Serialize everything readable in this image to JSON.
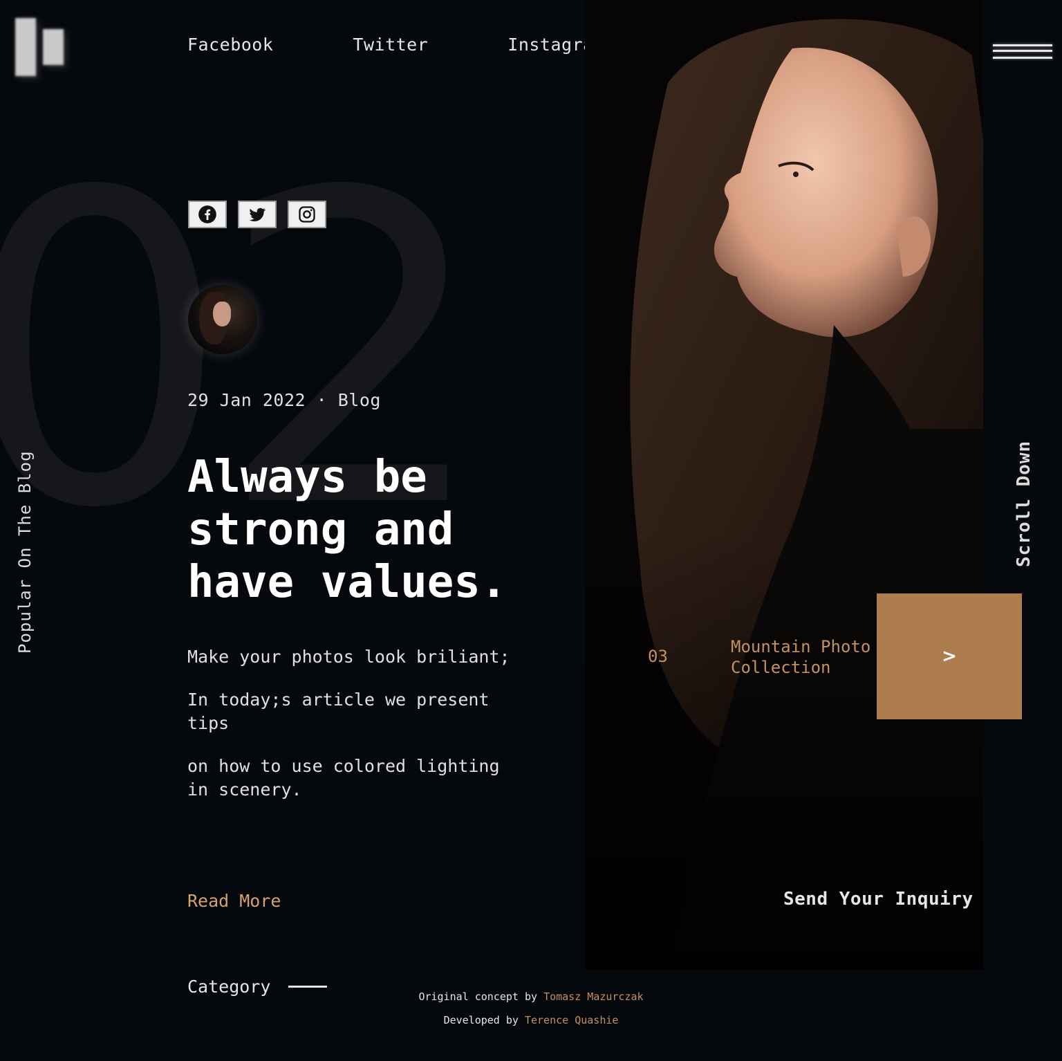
{
  "nav": {
    "links": [
      "Facebook",
      "Twitter",
      "Instagram"
    ]
  },
  "background_number": "02",
  "side_label": "Popular On The Blog",
  "social_icons": [
    "facebook-icon",
    "twitter-icon",
    "instagram-icon"
  ],
  "post": {
    "date": "29 Jan 2022",
    "separator": "·",
    "category": "Blog",
    "title_lines": [
      "Always be",
      "strong and",
      "have values."
    ],
    "paragraphs": [
      "Make your photos look briliant;",
      "In today;s article we present tips",
      "on how to use colored lighting in scenery."
    ],
    "read_more": "Read More"
  },
  "category_label": "Category",
  "credits": {
    "line1_prefix": "Original concept by",
    "line1_name": "Tomasz Mazurczak",
    "line2_prefix": "Developed by",
    "line2_name": "Terence Quashie"
  },
  "scroll_down": "Scroll Down",
  "next_item": {
    "number": "03",
    "title": "Mountain Photo Collection",
    "button_glyph": ">"
  },
  "inquiry": "Send Your Inquiry",
  "colors": {
    "background": "#05080c",
    "accent": "#c4915e",
    "button": "#ad7d4d",
    "text": "#e6e6e6"
  }
}
